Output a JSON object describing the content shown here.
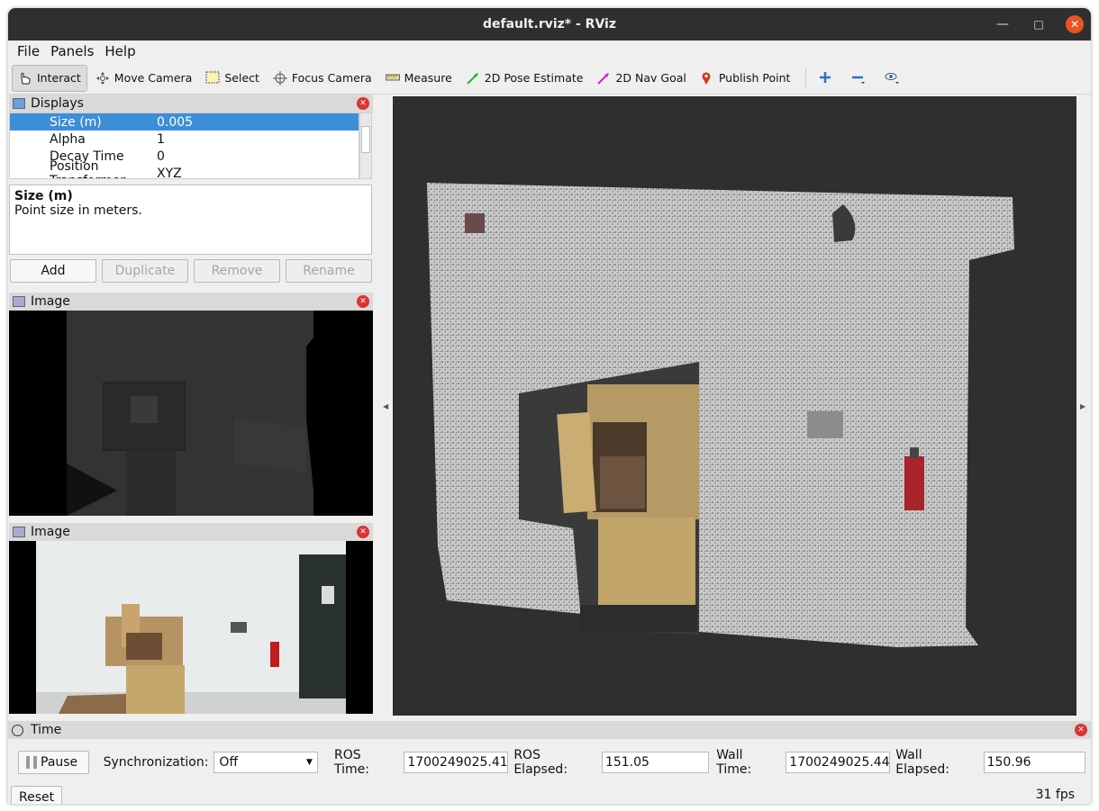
{
  "window": {
    "title": "default.rviz* - RViz"
  },
  "menu": {
    "file": "File",
    "panels": "Panels",
    "help": "Help"
  },
  "toolbar": {
    "interact": "Interact",
    "move_camera": "Move Camera",
    "select": "Select",
    "focus_camera": "Focus Camera",
    "measure": "Measure",
    "pose_estimate": "2D Pose Estimate",
    "nav_goal": "2D Nav Goal",
    "publish_point": "Publish Point"
  },
  "displays": {
    "title": "Displays",
    "properties": [
      {
        "name": "Size (m)",
        "value": "0.005"
      },
      {
        "name": "Alpha",
        "value": "1"
      },
      {
        "name": "Decay Time",
        "value": "0"
      },
      {
        "name": "Position Transformer",
        "value": "XYZ"
      }
    ],
    "desc_title": "Size (m)",
    "desc_text": "Point size in meters.",
    "buttons": {
      "add": "Add",
      "duplicate": "Duplicate",
      "remove": "Remove",
      "rename": "Rename"
    }
  },
  "image_panels": [
    {
      "title": "Image"
    },
    {
      "title": "Image"
    }
  ],
  "time": {
    "title": "Time",
    "pause": "Pause",
    "sync_label": "Synchronization:",
    "sync_value": "Off",
    "ros_time_label": "ROS Time:",
    "ros_time": "1700249025.41",
    "ros_elapsed_label": "ROS Elapsed:",
    "ros_elapsed": "151.05",
    "wall_time_label": "Wall Time:",
    "wall_time": "1700249025.44",
    "wall_elapsed_label": "Wall Elapsed:",
    "wall_elapsed": "150.96",
    "reset": "Reset",
    "fps": "31 fps"
  },
  "colors": {
    "title_bar": "#2f2f2f",
    "close_button": "#e95420",
    "selection": "#3c8ed6",
    "viewport_bg": "#2f2f2f"
  }
}
